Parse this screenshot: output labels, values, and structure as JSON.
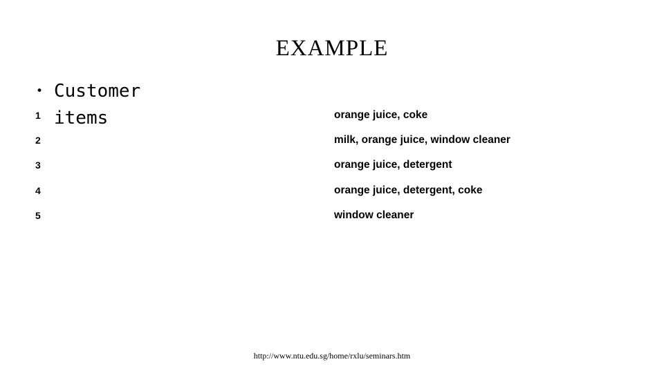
{
  "slide": {
    "title": "EXAMPLE",
    "background_color": "#ffffff",
    "text_color": "#000000"
  },
  "bullet_header": {
    "bullet_glyph": "•",
    "line_1": "Customer",
    "line_2": "items"
  },
  "transactions": {
    "rows": [
      {
        "number": "1",
        "items": "orange juice, coke"
      },
      {
        "number": "2",
        "items": "milk, orange juice, window cleaner"
      },
      {
        "number": "3",
        "items": "orange juice, detergent"
      },
      {
        "number": "4",
        "items": "orange juice, detergent, coke"
      },
      {
        "number": "5",
        "items": "window cleaner"
      }
    ]
  },
  "footer": {
    "url": "http://www.ntu.edu.sg/home/rxlu/seminars.htm"
  }
}
